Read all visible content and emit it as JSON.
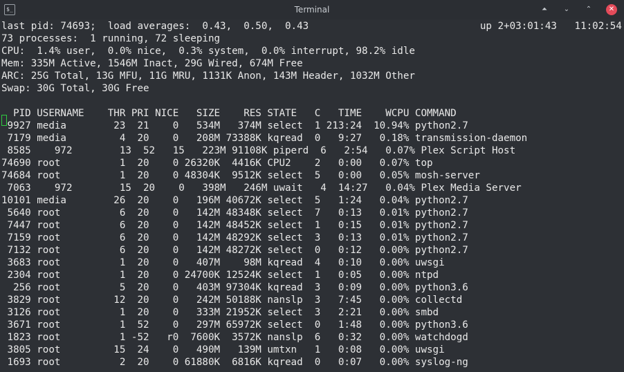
{
  "window": {
    "title": "Terminal",
    "icon_label": "$_",
    "controls": {
      "up": "⏶",
      "min": "⌄",
      "max": "⌃",
      "close": "✕"
    }
  },
  "header": {
    "l1": "last pid: 74693;  load averages:  0.43,  0.50,  0.43                             up 2+03:01:43   11:02:54",
    "l2": "73 processes:  1 running, 72 sleeping",
    "l3": "CPU:  1.4% user,  0.0% nice,  0.3% system,  0.0% interrupt, 98.2% idle",
    "l4": "Mem: 335M Active, 1546M Inact, 29G Wired, 674M Free",
    "l5": "ARC: 25G Total, 13G MFU, 11G MRU, 1131K Anon, 143M Header, 1032M Other",
    "l6": "Swap: 30G Total, 30G Free"
  },
  "process_table": {
    "header": "  PID USERNAME    THR PRI NICE   SIZE    RES STATE   C   TIME    WCPU COMMAND",
    "rows": [
      " 9927 media        23  21    0   534M   374M select  1 213:24  10.94% python2.7",
      " 7179 media         4  20    0   208M 73388K kqread  0   9:27   0.18% transmission-daemon",
      " 8585    972        13  52   15   223M 91108K piperd  6   2:54   0.07% Plex Script Host",
      "74690 root          1  20    0 26320K  4416K CPU2    2   0:00   0.07% top",
      "74684 root          1  20    0 48304K  9512K select  5   0:00   0.05% mosh-server",
      " 7063    972        15  20    0   398M   246M uwait   4  14:27   0.04% Plex Media Server",
      "10101 media        26  20    0   196M 40672K select  5   1:24   0.04% python2.7",
      " 5640 root          6  20    0   142M 48348K select  7   0:13   0.01% python2.7",
      " 7447 root          6  20    0   142M 48452K select  1   0:15   0.01% python2.7",
      " 7159 root          6  20    0   142M 48292K select  3   0:13   0.01% python2.7",
      " 7132 root          6  20    0   142M 48272K select  0   0:12   0.00% python2.7",
      " 3683 root          1  20    0   407M    98M kqread  4   0:10   0.00% uwsgi",
      " 2304 root          1  20    0 24700K 12524K select  1   0:05   0.00% ntpd",
      "  256 root          5  20    0   403M 97304K kqread  3   0:09   0.00% python3.6",
      " 3829 root         12  20    0   242M 50188K nanslp  3   7:45   0.00% collectd",
      " 3126 root          1  20    0   333M 21952K select  3   2:21   0.00% smbd",
      " 3671 root          1  52    0   297M 65972K select  0   1:48   0.00% python3.6",
      " 1823 root          1 -52   r0  7600K  3572K nanslp  6   0:32   0.00% watchdogd",
      " 3805 root         15  24    0   490M   139M umtxn   1   0:08   0.00% uwsgi",
      " 1693 root          2  20    0 61880K  6816K kqread  0   0:07   0.00% syslog-ng"
    ]
  }
}
